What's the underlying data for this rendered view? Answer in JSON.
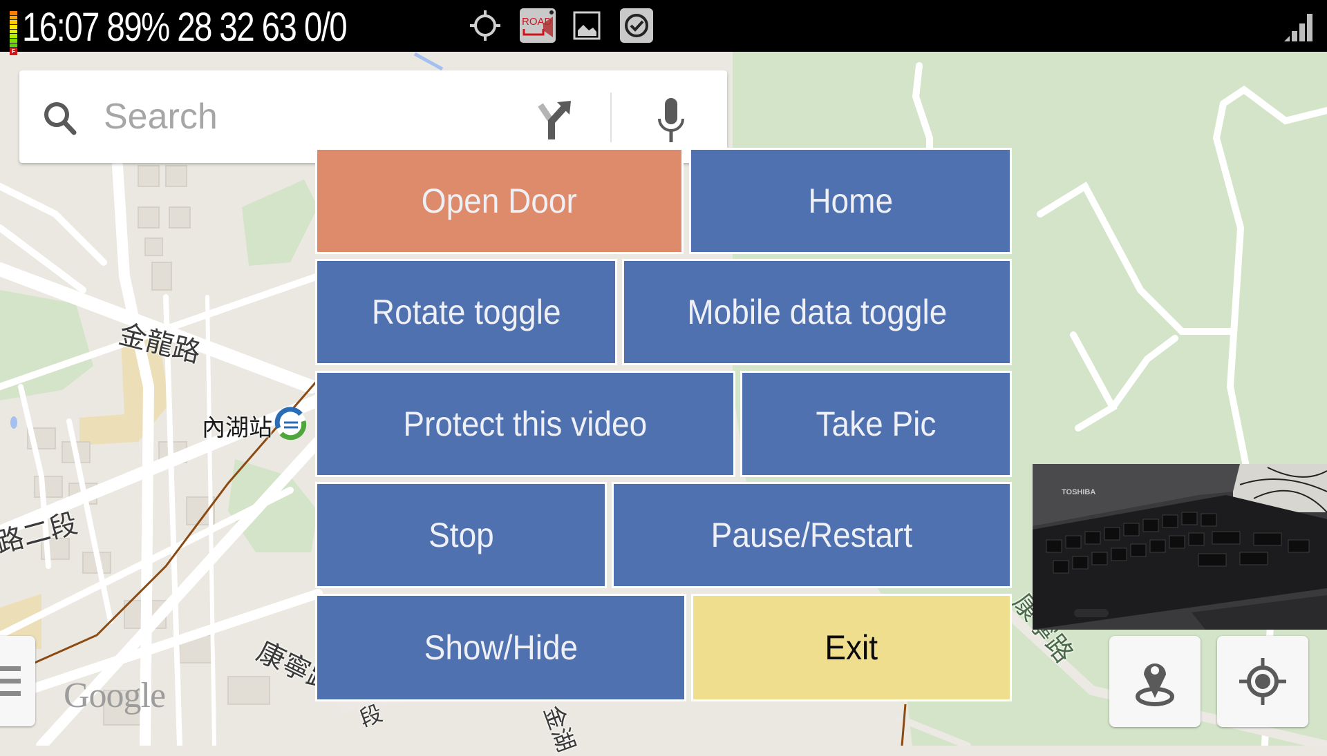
{
  "status_bar": {
    "text": "16:07 89% 28 32 63 0/0",
    "battery_gauge_label": "F",
    "icons": [
      "gps-crosshair-icon",
      "road-camera-icon",
      "image-icon",
      "checkmark-icon",
      "signal-strength-icon"
    ],
    "road_icon_label": "ROAD"
  },
  "search": {
    "placeholder": "Search",
    "value": "",
    "icons": [
      "search-icon",
      "directions-icon",
      "microphone-icon"
    ]
  },
  "overlay_buttons": [
    {
      "id": "open-door",
      "label": "Open Door",
      "color": "#de8b6c"
    },
    {
      "id": "home",
      "label": "Home",
      "color": "#5071b0"
    },
    {
      "id": "rotate-toggle",
      "label": "Rotate toggle",
      "color": "#5071b0"
    },
    {
      "id": "mobile-data-toggle",
      "label": "Mobile data toggle",
      "color": "#5071b0"
    },
    {
      "id": "protect-video",
      "label": "Protect this video",
      "color": "#5071b0"
    },
    {
      "id": "take-pic",
      "label": "Take Pic",
      "color": "#5071b0"
    },
    {
      "id": "stop",
      "label": "Stop",
      "color": "#5071b0"
    },
    {
      "id": "pause-restart",
      "label": "Pause/Restart",
      "color": "#5071b0"
    },
    {
      "id": "show-hide",
      "label": "Show/Hide",
      "color": "#5071b0"
    },
    {
      "id": "exit",
      "label": "Exit",
      "color": "#efde8e"
    }
  ],
  "map": {
    "labels": [
      "金龍路",
      "內湖站",
      "路二段",
      "康寧路",
      "康寧路",
      "段",
      "金湖"
    ],
    "attribution": "Google",
    "colors": {
      "land": "#ebe8e1",
      "park": "#d3e4c8",
      "road": "#ffffff",
      "block": "#e2ded6"
    }
  },
  "camera_preview": {
    "brand_text": "TOSHIBA"
  },
  "map_controls": {
    "menu": "menu-icon",
    "place_pin": "place-pin-icon",
    "my_location": "my-location-icon"
  }
}
